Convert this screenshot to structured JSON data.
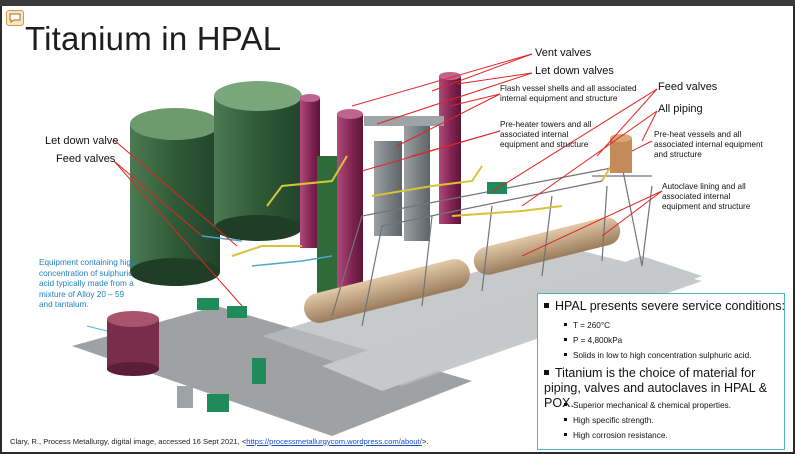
{
  "slide": {
    "title": "Titanium in HPAL"
  },
  "labels": {
    "vent_valves": "Vent valves",
    "let_down_valves": "Let down valves",
    "flash_vessel": "Flash vessel shells and all associated internal equipment and structure",
    "preheater_towers": "Pre-heater towers and all associated internal equipment and structure",
    "feed_valves_right": "Feed valves",
    "all_piping": "All piping",
    "preheat_vessels": "Pre-heat vessels and all associated internal equipment and structure",
    "autoclave_lining": "Autoclave lining and all associated internal equipment and structure",
    "let_down_valve_left": "Let down valve",
    "feed_valves_left": "Feed valves",
    "sulphuric_equipment": "Equipment containing high concentration of sulphuric acid typically made from a mixture of Alloy 20 – 59 and tantalum."
  },
  "infobox": {
    "heading1": "HPAL presents severe service conditions:",
    "conditions": [
      "T = 260°C",
      "P = 4,800kPa",
      "Solids in low to high concentration sulphuric acid."
    ],
    "heading2": "Titanium is the choice of material for piping, valves and autoclaves in HPAL & POX.",
    "properties": [
      "Superior mechanical & chemical properties.",
      "High specific strength.",
      "High corrosion resistance."
    ]
  },
  "citation": {
    "text": "Clary, R., Process Metallurgy, digital image, accessed 16 Sept 2021, <",
    "link": "https://processmetallurgycom.wordpress.com/about/",
    "suffix": ">."
  },
  "icons": {
    "comment": "comment-icon"
  },
  "colors": {
    "tank_green": "#3d6a45",
    "annotation_red": "#e02424",
    "info_border": "#49b5c7",
    "label_blue": "#1f7fc4",
    "structure_gray": "#a9acad",
    "vessel_magenta": "#8e2b5c",
    "pipe_yellow": "#d8c23a"
  }
}
